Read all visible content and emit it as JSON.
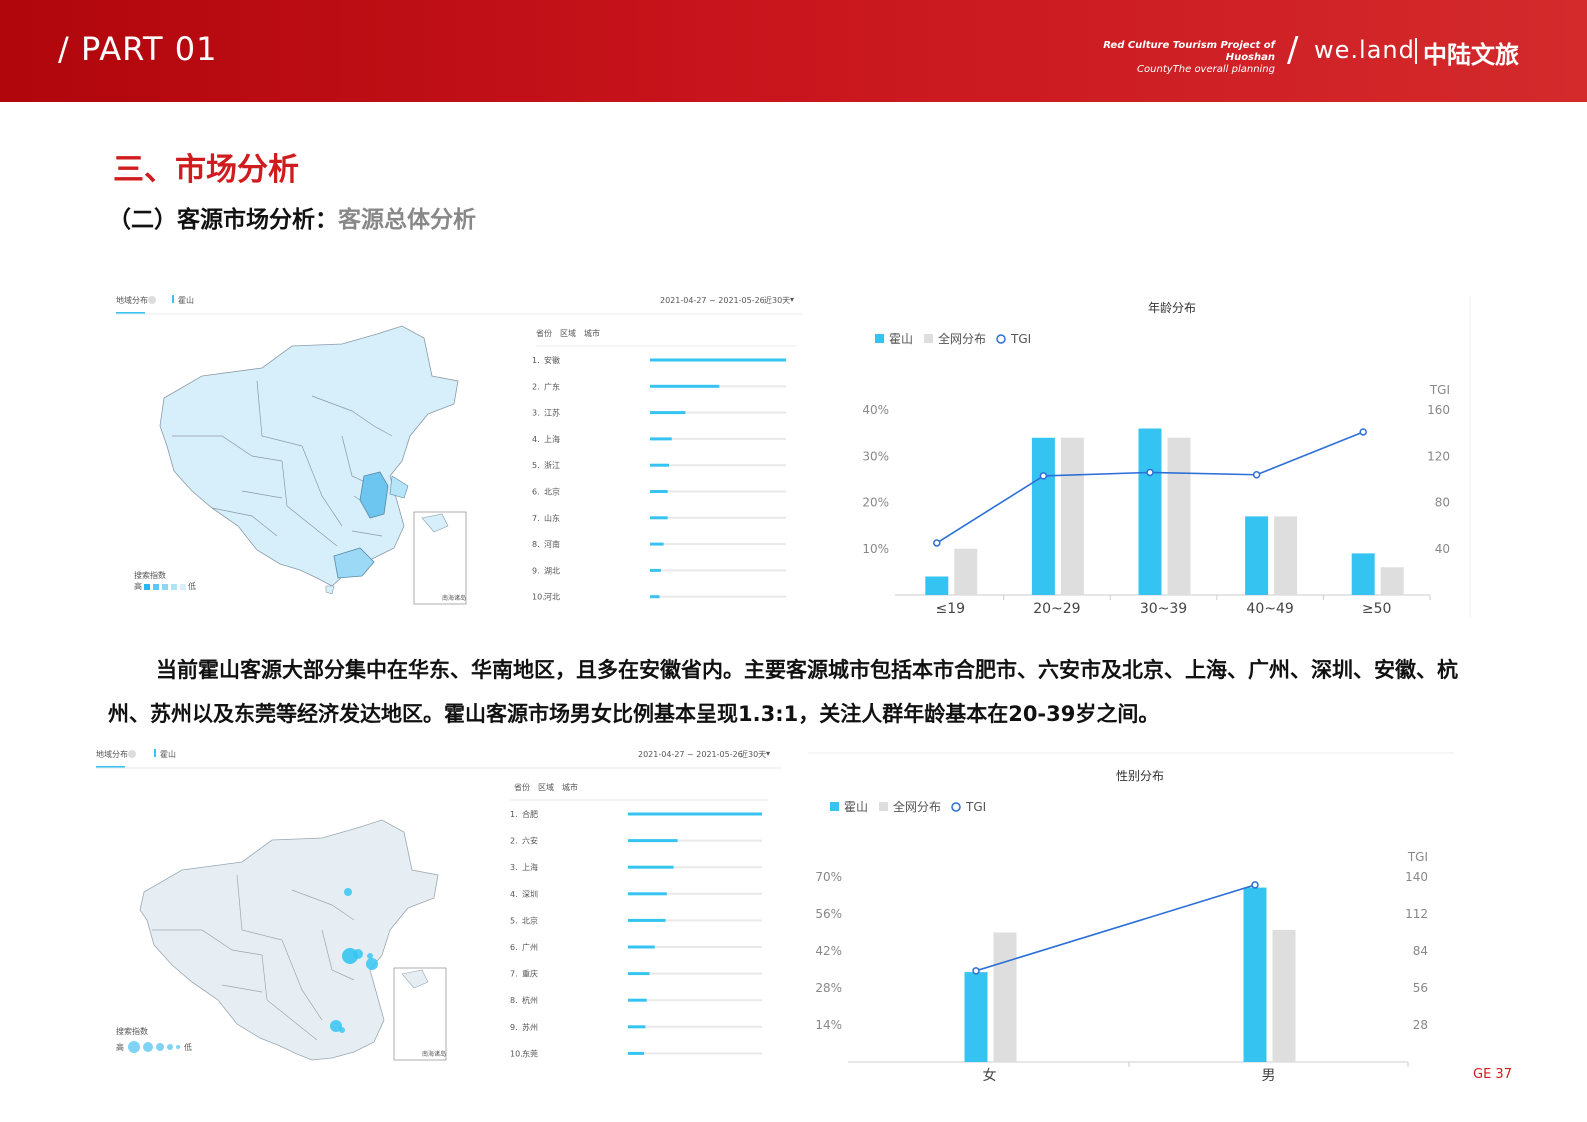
{
  "header": {
    "part": "/ PART 01",
    "project_line1": "Red Culture Tourism Project of Huoshan",
    "project_line2": "CountyThe overall planning",
    "slash": "/",
    "brand": "we.land",
    "brand_cn": "中陆文旅"
  },
  "title": "三、市场分析",
  "subtitle_main": "（二）客源市场分析：",
  "subtitle_grey": "客源总体分析",
  "paragraph": "当前霍山客源大部分集中在华东、华南地区，且多在安徽省内。主要客源城市包括本市合肥市、六安市及北京、上海、广州、深圳、安徽、杭州、苏州以及东莞等经济发达地区。霍山客源市场男女比例基本呈现1.3:1，关注人群年龄基本在20-39岁之间。",
  "page_number": "GE 37",
  "colors": {
    "accent": "#d01c1f",
    "series_blue": "#35c4f2",
    "series_grey": "#dedede",
    "tgi": "#2c6fd6"
  },
  "map_province": {
    "tab_label": "地域分布",
    "keyword": "霍山",
    "date_range": "2021-04-27 ~ 2021-05-26",
    "period": "近30天",
    "col_headers": [
      "省份",
      "区域",
      "城市"
    ],
    "legend_title": "搜索指数",
    "legend_high": "高",
    "legend_low": "低",
    "inset_label": "南海诸岛",
    "rows": [
      {
        "rank": "1.",
        "name": "安徽",
        "value": 1.0
      },
      {
        "rank": "2.",
        "name": "广东",
        "value": 0.51
      },
      {
        "rank": "3.",
        "name": "江苏",
        "value": 0.26
      },
      {
        "rank": "4.",
        "name": "上海",
        "value": 0.16
      },
      {
        "rank": "5.",
        "name": "浙江",
        "value": 0.14
      },
      {
        "rank": "6.",
        "name": "北京",
        "value": 0.13
      },
      {
        "rank": "7.",
        "name": "山东",
        "value": 0.13
      },
      {
        "rank": "8.",
        "name": "河南",
        "value": 0.1
      },
      {
        "rank": "9.",
        "name": "湖北",
        "value": 0.08
      },
      {
        "rank": "10.",
        "name": "河北",
        "value": 0.07
      }
    ]
  },
  "map_city": {
    "tab_label": "地域分布",
    "keyword": "霍山",
    "date_range": "2021-04-27 ~ 2021-05-26",
    "period": "近30天",
    "col_headers": [
      "省份",
      "区域",
      "城市"
    ],
    "legend_title": "搜索指数",
    "legend_high": "高",
    "legend_low": "低",
    "inset_label": "南海诸岛",
    "rows": [
      {
        "rank": "1.",
        "name": "合肥",
        "value": 1.0
      },
      {
        "rank": "2.",
        "name": "六安",
        "value": 0.37
      },
      {
        "rank": "3.",
        "name": "上海",
        "value": 0.34
      },
      {
        "rank": "4.",
        "name": "深圳",
        "value": 0.29
      },
      {
        "rank": "5.",
        "name": "北京",
        "value": 0.28
      },
      {
        "rank": "6.",
        "name": "广州",
        "value": 0.2
      },
      {
        "rank": "7.",
        "name": "重庆",
        "value": 0.16
      },
      {
        "rank": "8.",
        "name": "杭州",
        "value": 0.14
      },
      {
        "rank": "9.",
        "name": "苏州",
        "value": 0.13
      },
      {
        "rank": "10.",
        "name": "东莞",
        "value": 0.12
      }
    ]
  },
  "chart_data": [
    {
      "type": "bar",
      "title": "年龄分布",
      "categories": [
        "≤19",
        "20~29",
        "30~39",
        "40~49",
        "≥50"
      ],
      "series": [
        {
          "name": "霍山",
          "values": [
            4,
            34,
            36,
            17,
            9
          ]
        },
        {
          "name": "全网分布",
          "values": [
            10,
            34,
            34,
            17,
            6
          ]
        },
        {
          "name": "TGI",
          "values": [
            45,
            103,
            106,
            104,
            141
          ],
          "axis": "right"
        }
      ],
      "y_ticks": [
        "10%",
        "20%",
        "30%",
        "40%"
      ],
      "ylim": [
        0,
        40
      ],
      "y2label": "TGI",
      "y2_ticks": [
        "40",
        "80",
        "120",
        "160"
      ],
      "y2lim": [
        0,
        160
      ],
      "legend": "top-left"
    },
    {
      "type": "bar",
      "title": "性别分布",
      "categories": [
        "女",
        "男"
      ],
      "series": [
        {
          "name": "霍山",
          "values": [
            34,
            66
          ]
        },
        {
          "name": "全网分布",
          "values": [
            49,
            50
          ]
        },
        {
          "name": "TGI",
          "values": [
            69,
            134
          ],
          "axis": "right"
        }
      ],
      "y_ticks": [
        "14%",
        "28%",
        "42%",
        "56%",
        "70%"
      ],
      "ylim": [
        0,
        70
      ],
      "y2label": "TGI",
      "y2_ticks": [
        "28",
        "56",
        "84",
        "112",
        "140"
      ],
      "y2lim": [
        0,
        140
      ],
      "legend": "top-left"
    }
  ]
}
